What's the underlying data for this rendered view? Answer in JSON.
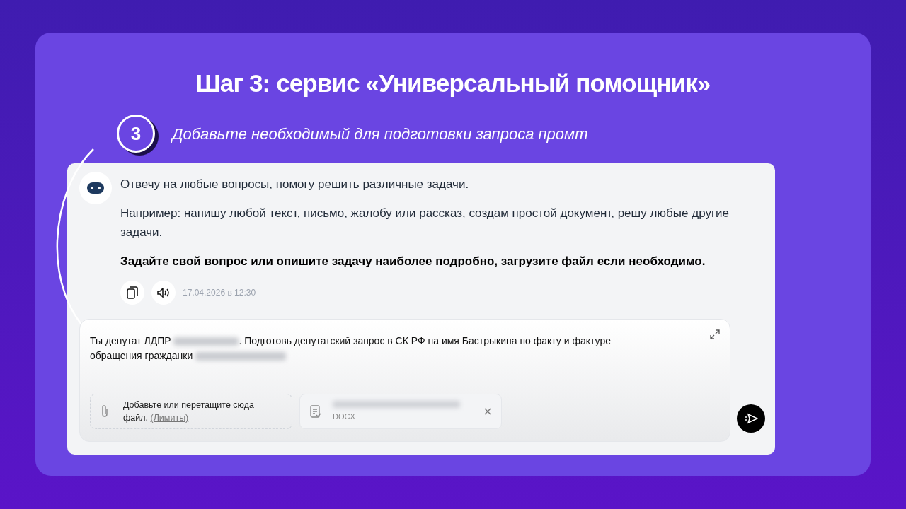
{
  "title": "Шаг 3: сервис «Универсальный помощник»",
  "step": {
    "number": "3",
    "text": "Добавьте необходимый для подготовки запроса промт"
  },
  "message": {
    "paragraphs": [
      {
        "text": "Отвечу на любые вопросы, помогу решить различные задачи.",
        "bold": false
      },
      {
        "text": "Например: напишу любой текст, письмо, жалобу или рассказ, создам простой документ, решу любые другие задачи.",
        "bold": false
      },
      {
        "text": "Задайте свой вопрос или опишите задачу наиболее подробно, загрузите файл если необходимо.",
        "bold": true
      }
    ],
    "timestamp": "17.04.2026 в 12:30"
  },
  "prompt": {
    "parts": [
      "Ты депутат ЛДПР",
      ". Подготовь депутатский запрос в СК РФ на имя Бастрыкина по факту и фактуре обращения гражданки"
    ]
  },
  "upload": {
    "text": "Добавьте или перетащите сюда файл.",
    "link": "(Лимиты)"
  },
  "attachment": {
    "type": "DOCX"
  }
}
